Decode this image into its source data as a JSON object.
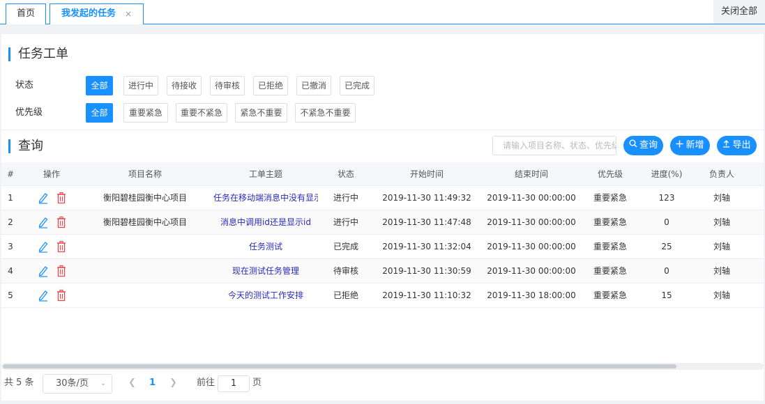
{
  "tabs": {
    "home": "首页",
    "active": "我发起的任务",
    "close_glyph": "×",
    "close_all": "关闭全部"
  },
  "section_title": "任务工单",
  "filters": {
    "status_label": "状态",
    "status_options": [
      "全部",
      "进行中",
      "待接收",
      "待审核",
      "已拒绝",
      "已撤消",
      "已完成"
    ],
    "priority_label": "优先级",
    "priority_options": [
      "全部",
      "重要紧急",
      "重要不紧急",
      "紧急不重要",
      "不紧急不重要"
    ]
  },
  "query": {
    "title": "查询",
    "search_placeholder": "请输入项目名称、状态、优先级",
    "search_button": "查询",
    "add_button": "新增",
    "export_button": "导出"
  },
  "table": {
    "columns": [
      "#",
      "操作",
      "项目名称",
      "工单主题",
      "状态",
      "开始时间",
      "结束时间",
      "优先级",
      "进度(%)",
      "负责人"
    ],
    "rows": [
      {
        "idx": "1",
        "project": "衡阳碧桂园衡中心项目",
        "subject": "任务在移动端消息中没有显示",
        "status": "进行中",
        "start": "2019-11-30 11:49:32",
        "end": "2019-11-30 00:00:00",
        "priority": "重要紧急",
        "progress": "123",
        "owner": "刘轴"
      },
      {
        "idx": "2",
        "project": "衡阳碧桂园衡中心项目",
        "subject": "消息中调用id还是显示id",
        "status": "进行中",
        "start": "2019-11-30 11:47:48",
        "end": "2019-11-30 00:00:00",
        "priority": "重要紧急",
        "progress": "0",
        "owner": "刘轴"
      },
      {
        "idx": "3",
        "project": "",
        "subject": "任务测试",
        "status": "已完成",
        "start": "2019-11-30 11:32:04",
        "end": "2019-11-30 00:00:00",
        "priority": "重要紧急",
        "progress": "25",
        "owner": "刘轴"
      },
      {
        "idx": "4",
        "project": "",
        "subject": "现在测试任务管理",
        "status": "待审核",
        "start": "2019-11-30 11:30:59",
        "end": "2019-11-30 00:00:00",
        "priority": "重要紧急",
        "progress": "0",
        "owner": "刘轴"
      },
      {
        "idx": "5",
        "project": "",
        "subject": "今天的测试工作安排",
        "status": "已拒绝",
        "start": "2019-11-30 11:10:32",
        "end": "2019-11-30 18:00:00",
        "priority": "重要紧急",
        "progress": "15",
        "owner": "刘轴"
      }
    ]
  },
  "pagination": {
    "total": "共 5 条",
    "page_size": "30条/页",
    "current_page": "1",
    "goto_label": "前往",
    "goto_value": "1",
    "page_suffix": "页"
  },
  "colors": {
    "accent": "#1890ff",
    "delete": "#e5484d",
    "link": "#2a2ab8"
  },
  "icons": {
    "edit": "edit-icon",
    "delete": "delete-icon",
    "search": "search-icon",
    "add": "plus-icon",
    "export": "export-icon"
  }
}
